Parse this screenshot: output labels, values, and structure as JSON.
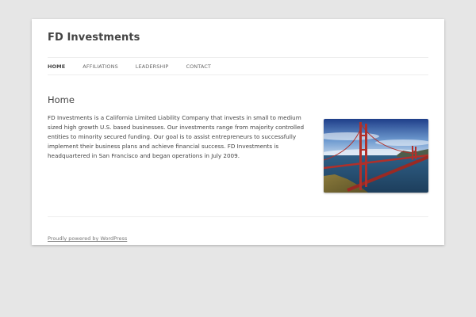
{
  "site": {
    "title": "FD Investments"
  },
  "nav": {
    "items": [
      {
        "label": "Home",
        "current": true
      },
      {
        "label": "Affiliations",
        "current": false
      },
      {
        "label": "Leadership",
        "current": false
      },
      {
        "label": "Contact",
        "current": false
      }
    ]
  },
  "main": {
    "page_title": "Home",
    "body_text": "FD Investments is a California Limited Liability Company that invests in small to medium sized high growth U.S. based businesses. Our investments range from majority controlled entities to minority secured funding. Our goal is to assist entrepreneurs to successfully implement their business plans and achieve financial success. FD Investments is headquartered in San Francisco and began operations in July 2009."
  },
  "footer": {
    "credit": "Proudly powered by WordPress"
  },
  "colors": {
    "page_bg": "#e6e6e6",
    "content_bg": "#ffffff",
    "text": "#444444",
    "bridge": "#b0302a"
  },
  "icons": {
    "photo": "golden-gate-bridge-image"
  }
}
